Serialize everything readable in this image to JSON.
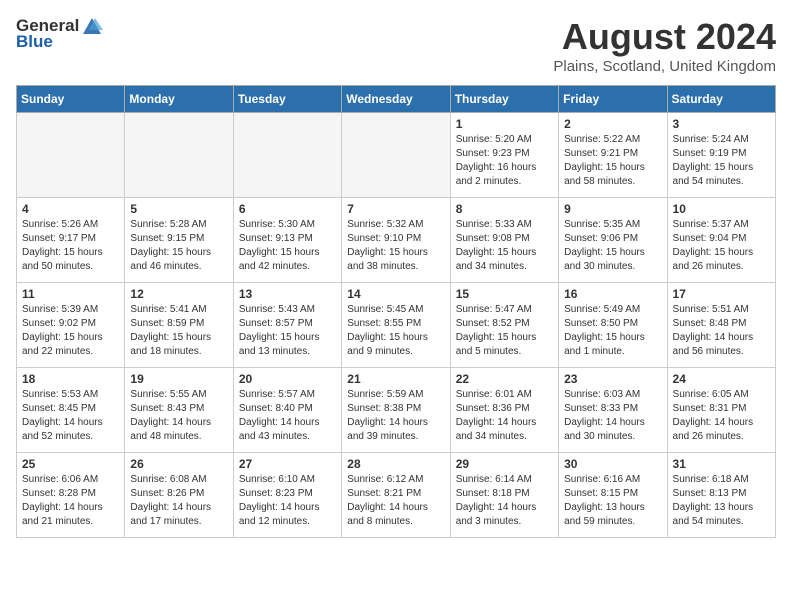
{
  "header": {
    "logo_general": "General",
    "logo_blue": "Blue",
    "title": "August 2024",
    "subtitle": "Plains, Scotland, United Kingdom"
  },
  "calendar": {
    "days_of_week": [
      "Sunday",
      "Monday",
      "Tuesday",
      "Wednesday",
      "Thursday",
      "Friday",
      "Saturday"
    ],
    "weeks": [
      [
        {
          "day": "",
          "empty": true
        },
        {
          "day": "",
          "empty": true
        },
        {
          "day": "",
          "empty": true
        },
        {
          "day": "",
          "empty": true
        },
        {
          "day": "1",
          "sunrise": "Sunrise: 5:20 AM",
          "sunset": "Sunset: 9:23 PM",
          "daylight": "Daylight: 16 hours and 2 minutes."
        },
        {
          "day": "2",
          "sunrise": "Sunrise: 5:22 AM",
          "sunset": "Sunset: 9:21 PM",
          "daylight": "Daylight: 15 hours and 58 minutes."
        },
        {
          "day": "3",
          "sunrise": "Sunrise: 5:24 AM",
          "sunset": "Sunset: 9:19 PM",
          "daylight": "Daylight: 15 hours and 54 minutes."
        }
      ],
      [
        {
          "day": "4",
          "sunrise": "Sunrise: 5:26 AM",
          "sunset": "Sunset: 9:17 PM",
          "daylight": "Daylight: 15 hours and 50 minutes."
        },
        {
          "day": "5",
          "sunrise": "Sunrise: 5:28 AM",
          "sunset": "Sunset: 9:15 PM",
          "daylight": "Daylight: 15 hours and 46 minutes."
        },
        {
          "day": "6",
          "sunrise": "Sunrise: 5:30 AM",
          "sunset": "Sunset: 9:13 PM",
          "daylight": "Daylight: 15 hours and 42 minutes."
        },
        {
          "day": "7",
          "sunrise": "Sunrise: 5:32 AM",
          "sunset": "Sunset: 9:10 PM",
          "daylight": "Daylight: 15 hours and 38 minutes."
        },
        {
          "day": "8",
          "sunrise": "Sunrise: 5:33 AM",
          "sunset": "Sunset: 9:08 PM",
          "daylight": "Daylight: 15 hours and 34 minutes."
        },
        {
          "day": "9",
          "sunrise": "Sunrise: 5:35 AM",
          "sunset": "Sunset: 9:06 PM",
          "daylight": "Daylight: 15 hours and 30 minutes."
        },
        {
          "day": "10",
          "sunrise": "Sunrise: 5:37 AM",
          "sunset": "Sunset: 9:04 PM",
          "daylight": "Daylight: 15 hours and 26 minutes."
        }
      ],
      [
        {
          "day": "11",
          "sunrise": "Sunrise: 5:39 AM",
          "sunset": "Sunset: 9:02 PM",
          "daylight": "Daylight: 15 hours and 22 minutes."
        },
        {
          "day": "12",
          "sunrise": "Sunrise: 5:41 AM",
          "sunset": "Sunset: 8:59 PM",
          "daylight": "Daylight: 15 hours and 18 minutes."
        },
        {
          "day": "13",
          "sunrise": "Sunrise: 5:43 AM",
          "sunset": "Sunset: 8:57 PM",
          "daylight": "Daylight: 15 hours and 13 minutes."
        },
        {
          "day": "14",
          "sunrise": "Sunrise: 5:45 AM",
          "sunset": "Sunset: 8:55 PM",
          "daylight": "Daylight: 15 hours and 9 minutes."
        },
        {
          "day": "15",
          "sunrise": "Sunrise: 5:47 AM",
          "sunset": "Sunset: 8:52 PM",
          "daylight": "Daylight: 15 hours and 5 minutes."
        },
        {
          "day": "16",
          "sunrise": "Sunrise: 5:49 AM",
          "sunset": "Sunset: 8:50 PM",
          "daylight": "Daylight: 15 hours and 1 minute."
        },
        {
          "day": "17",
          "sunrise": "Sunrise: 5:51 AM",
          "sunset": "Sunset: 8:48 PM",
          "daylight": "Daylight: 14 hours and 56 minutes."
        }
      ],
      [
        {
          "day": "18",
          "sunrise": "Sunrise: 5:53 AM",
          "sunset": "Sunset: 8:45 PM",
          "daylight": "Daylight: 14 hours and 52 minutes."
        },
        {
          "day": "19",
          "sunrise": "Sunrise: 5:55 AM",
          "sunset": "Sunset: 8:43 PM",
          "daylight": "Daylight: 14 hours and 48 minutes."
        },
        {
          "day": "20",
          "sunrise": "Sunrise: 5:57 AM",
          "sunset": "Sunset: 8:40 PM",
          "daylight": "Daylight: 14 hours and 43 minutes."
        },
        {
          "day": "21",
          "sunrise": "Sunrise: 5:59 AM",
          "sunset": "Sunset: 8:38 PM",
          "daylight": "Daylight: 14 hours and 39 minutes."
        },
        {
          "day": "22",
          "sunrise": "Sunrise: 6:01 AM",
          "sunset": "Sunset: 8:36 PM",
          "daylight": "Daylight: 14 hours and 34 minutes."
        },
        {
          "day": "23",
          "sunrise": "Sunrise: 6:03 AM",
          "sunset": "Sunset: 8:33 PM",
          "daylight": "Daylight: 14 hours and 30 minutes."
        },
        {
          "day": "24",
          "sunrise": "Sunrise: 6:05 AM",
          "sunset": "Sunset: 8:31 PM",
          "daylight": "Daylight: 14 hours and 26 minutes."
        }
      ],
      [
        {
          "day": "25",
          "sunrise": "Sunrise: 6:06 AM",
          "sunset": "Sunset: 8:28 PM",
          "daylight": "Daylight: 14 hours and 21 minutes."
        },
        {
          "day": "26",
          "sunrise": "Sunrise: 6:08 AM",
          "sunset": "Sunset: 8:26 PM",
          "daylight": "Daylight: 14 hours and 17 minutes."
        },
        {
          "day": "27",
          "sunrise": "Sunrise: 6:10 AM",
          "sunset": "Sunset: 8:23 PM",
          "daylight": "Daylight: 14 hours and 12 minutes."
        },
        {
          "day": "28",
          "sunrise": "Sunrise: 6:12 AM",
          "sunset": "Sunset: 8:21 PM",
          "daylight": "Daylight: 14 hours and 8 minutes."
        },
        {
          "day": "29",
          "sunrise": "Sunrise: 6:14 AM",
          "sunset": "Sunset: 8:18 PM",
          "daylight": "Daylight: 14 hours and 3 minutes."
        },
        {
          "day": "30",
          "sunrise": "Sunrise: 6:16 AM",
          "sunset": "Sunset: 8:15 PM",
          "daylight": "Daylight: 13 hours and 59 minutes."
        },
        {
          "day": "31",
          "sunrise": "Sunrise: 6:18 AM",
          "sunset": "Sunset: 8:13 PM",
          "daylight": "Daylight: 13 hours and 54 minutes."
        }
      ]
    ]
  }
}
